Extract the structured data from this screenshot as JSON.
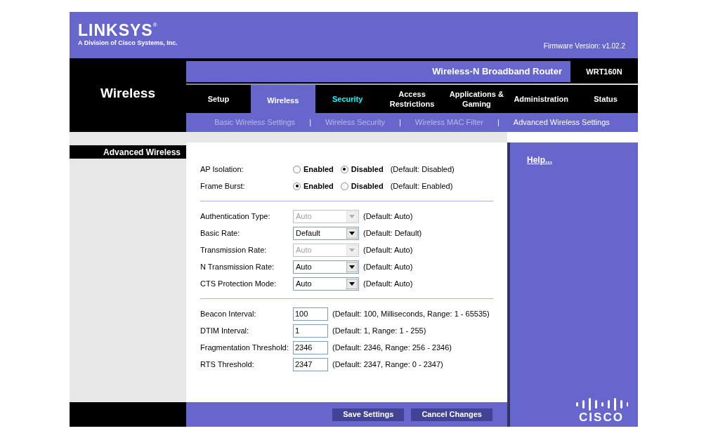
{
  "header": {
    "logo": "LINKSYS",
    "logo_mark": "®",
    "tagline": "A Division of Cisco Systems, Inc.",
    "firmware": "Firmware Version: v1.02.2"
  },
  "product": {
    "name": "Wireless-N Broadband Router",
    "model": "WRT160N"
  },
  "section_title": "Wireless",
  "tabs": [
    {
      "label": "Setup",
      "selected": false,
      "highlighted": false
    },
    {
      "label": "Wireless",
      "selected": true,
      "highlighted": false
    },
    {
      "label": "Security",
      "selected": false,
      "highlighted": true
    },
    {
      "label": "Access Restrictions",
      "selected": false,
      "highlighted": false
    },
    {
      "label": "Applications & Gaming",
      "selected": false,
      "highlighted": false
    },
    {
      "label": "Administration",
      "selected": false,
      "highlighted": false
    },
    {
      "label": "Status",
      "selected": false,
      "highlighted": false
    }
  ],
  "subtabs": [
    {
      "label": "Basic Wireless Settings",
      "selected": false
    },
    {
      "label": "Wireless Security",
      "selected": false
    },
    {
      "label": "Wireless MAC Filter",
      "selected": false
    },
    {
      "label": "Advanced Wireless Settings",
      "selected": true
    }
  ],
  "subtab_separator": "|",
  "sidebar": {
    "heading": "Advanced Wireless"
  },
  "groups": [
    [
      {
        "kind": "radio",
        "label": "AP Isolation:",
        "options": [
          {
            "label": "Enabled",
            "selected": false
          },
          {
            "label": "Disabled",
            "selected": true
          }
        ],
        "note": "(Default: Disabled)"
      },
      {
        "kind": "radio",
        "label": "Frame Burst:",
        "options": [
          {
            "label": "Enabled",
            "selected": true
          },
          {
            "label": "Disabled",
            "selected": false
          }
        ],
        "note": "(Default: Enabled)"
      }
    ],
    [
      {
        "kind": "select",
        "label": "Authentication Type:",
        "value": "Auto",
        "disabled": true,
        "note": "(Default: Auto)"
      },
      {
        "kind": "select",
        "label": "Basic Rate:",
        "value": "Default",
        "disabled": false,
        "note": "(Default: Default)"
      },
      {
        "kind": "select",
        "label": "Transmission Rate:",
        "value": "Auto",
        "disabled": true,
        "note": "(Default: Auto)"
      },
      {
        "kind": "select",
        "label": "N Transmission Rate:",
        "value": "Auto",
        "disabled": false,
        "note": "(Default: Auto)"
      },
      {
        "kind": "select",
        "label": "CTS Protection Mode:",
        "value": "Auto",
        "disabled": false,
        "note": "(Default: Auto)"
      }
    ],
    [
      {
        "kind": "text",
        "label": "Beacon Interval:",
        "value": "100",
        "note": "(Default: 100, Milliseconds, Range: 1 - 65535)"
      },
      {
        "kind": "text",
        "label": "DTIM Interval:",
        "value": "1",
        "note": "(Default: 1, Range: 1 - 255)"
      },
      {
        "kind": "text",
        "label": "Fragmentation Threshold:",
        "value": "2346",
        "note": "(Default: 2346, Range: 256 - 2346)"
      },
      {
        "kind": "text",
        "label": "RTS Threshold:",
        "value": "2347",
        "note": "(Default: 2347, Range: 0 - 2347)"
      }
    ]
  ],
  "help_link": "Help...",
  "buttons": [
    "Save Settings",
    "Cancel Changes"
  ],
  "footer_logo": "CISCO"
}
